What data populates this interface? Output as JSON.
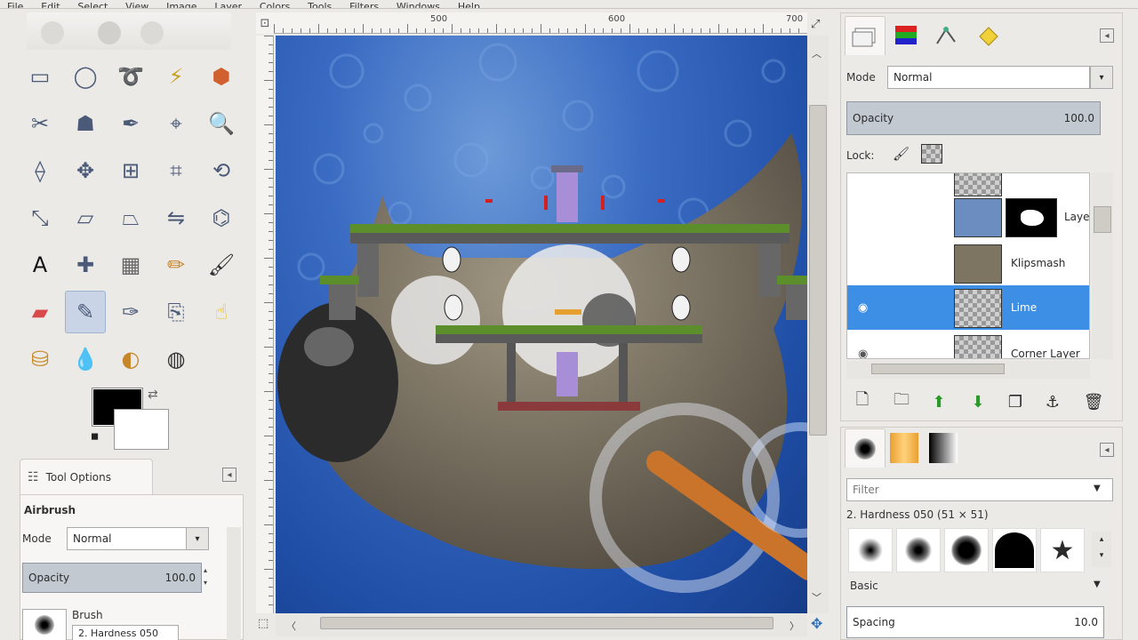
{
  "menubar": {
    "items": [
      "File",
      "Edit",
      "Select",
      "View",
      "Image",
      "Layer",
      "Colors",
      "Tools",
      "Filters",
      "Windows",
      "Help"
    ]
  },
  "toolbox": {
    "tools": [
      "rect-select-icon",
      "ellipse-select-icon",
      "free-select-icon",
      "fuzzy-select-icon",
      "select-by-color-icon",
      "scissors-icon",
      "foreground-select-icon",
      "paths-icon",
      "color-picker-icon",
      "zoom-icon",
      "measure-icon",
      "move-icon",
      "align-icon",
      "crop-icon",
      "rotate-icon",
      "scale-icon",
      "shear-icon",
      "perspective-icon",
      "flip-icon",
      "cage-icon",
      "text-icon",
      "heal-icon",
      "blend-icon",
      "pencil-icon",
      "paintbrush-icon",
      "eraser-icon",
      "airbrush-icon",
      "ink-icon",
      "clone-icon",
      "smudge-icon",
      "bucket-icon",
      "blur-icon",
      "dodge-icon",
      "warp-icon"
    ],
    "active_tool": "airbrush-icon"
  },
  "colors": {
    "foreground": "#000000",
    "background": "#ffffff"
  },
  "tool_options": {
    "tab_label": "Tool Options",
    "tool_name": "Airbrush",
    "mode_label": "Mode",
    "mode_value": "Normal",
    "opacity_label": "Opacity",
    "opacity_value": "100.0",
    "brush_label": "Brush",
    "brush_value": "2. Hardness 050"
  },
  "canvas": {
    "ruler_numbers": [
      "500",
      "600",
      "700"
    ]
  },
  "layers_panel": {
    "mode_label": "Mode",
    "mode_value": "Normal",
    "opacity_label": "Opacity",
    "opacity_value": "100.0",
    "lock_label": "Lock:",
    "layers": [
      {
        "name": "",
        "visible": false,
        "selected": false
      },
      {
        "name": "Layer",
        "visible": false,
        "selected": false
      },
      {
        "name": "Klipsmash",
        "visible": false,
        "selected": false
      },
      {
        "name": "Lime",
        "visible": true,
        "selected": true
      },
      {
        "name": "Corner Layer",
        "visible": true,
        "selected": false
      }
    ]
  },
  "brushes_panel": {
    "filter_placeholder": "Filter",
    "brush_title": "2. Hardness 050 (51 × 51)",
    "preset_label": "Basic",
    "spacing_label": "Spacing",
    "spacing_value": "10.0"
  }
}
